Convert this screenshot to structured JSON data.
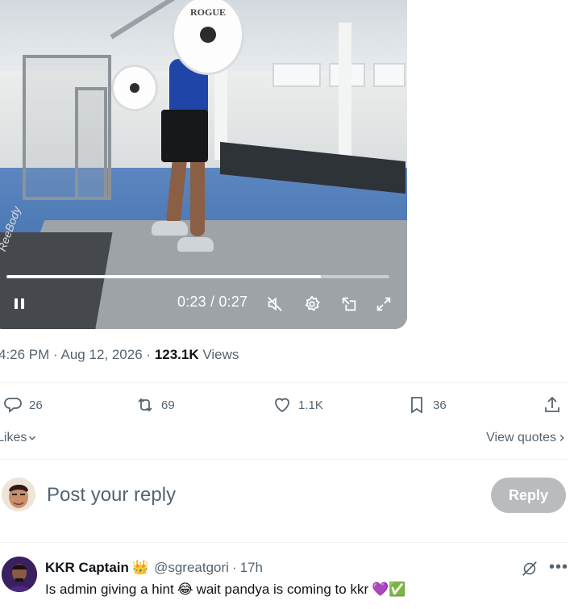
{
  "video": {
    "plate_text": "ROGUE",
    "watermark": "ReeBody",
    "progress_fraction": 0.82,
    "time_display": "0:23 / 0:27",
    "controls": {
      "pause": "pause-icon",
      "mute": "muted-speaker-icon",
      "settings": "gear-icon",
      "popout": "picture-in-picture-icon",
      "fullscreen": "fullscreen-icon"
    }
  },
  "meta": {
    "time": "4:26 PM",
    "separator": "·",
    "date": "Aug 12, 2026",
    "views_count": "123.1K",
    "views_label": "Views"
  },
  "actions": {
    "replies": "26",
    "reposts": "69",
    "likes": "1.1K",
    "bookmarks": "36"
  },
  "likes_row": {
    "likes_label": "Likes",
    "view_quotes": "View quotes"
  },
  "composer": {
    "placeholder": "Post your reply",
    "reply_button": "Reply"
  },
  "reply": {
    "name": "KKR Captain",
    "badge_emoji": "👑",
    "handle": "@sgreatgori",
    "separator": "·",
    "age": "17h",
    "text": "Is admin giving a hint",
    "emoji_1": "😂",
    "text_2": "wait pandya is coming to kkr",
    "emoji_2": "💜",
    "emoji_3": "✅"
  },
  "colors": {
    "secondary_text": "#536471",
    "primary_text": "#0f1419",
    "reply_button_disabled": "#b8bcbf",
    "divider": "#eff3f4"
  }
}
